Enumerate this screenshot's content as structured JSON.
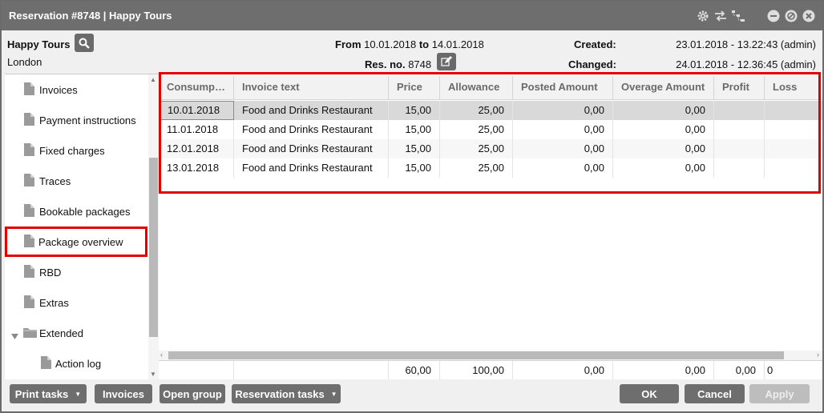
{
  "window": {
    "title": "Reservation #8748 | Happy Tours"
  },
  "header": {
    "name": "Happy Tours",
    "city": "London",
    "from_label": "From",
    "from_date": "10.01.2018",
    "to_label": "to",
    "to_date": "14.01.2018",
    "resno_label": "Res. no.",
    "resno": "8748",
    "created_label": "Created:",
    "created_value": "23.01.2018 - 13.22:43 (admin)",
    "changed_label": "Changed:",
    "changed_value": "24.01.2018 - 12.36:45 (admin)"
  },
  "sidebar": {
    "items": [
      {
        "label": "Invoices"
      },
      {
        "label": "Payment instructions"
      },
      {
        "label": "Fixed charges"
      },
      {
        "label": "Traces"
      },
      {
        "label": "Bookable packages"
      },
      {
        "label": "Package overview"
      },
      {
        "label": "RBD"
      },
      {
        "label": "Extras"
      },
      {
        "label": "Extended"
      },
      {
        "label": "Action log"
      }
    ]
  },
  "table": {
    "columns": [
      "Consump…",
      "Invoice text",
      "Price",
      "Allowance",
      "Posted Amount",
      "Overage Amount",
      "Profit",
      "Loss"
    ],
    "rows": [
      [
        "10.01.2018",
        "Food and Drinks Restaurant",
        "15,00",
        "25,00",
        "0,00",
        "0,00",
        "",
        ""
      ],
      [
        "11.01.2018",
        "Food and Drinks Restaurant",
        "15,00",
        "25,00",
        "0,00",
        "0,00",
        "",
        ""
      ],
      [
        "12.01.2018",
        "Food and Drinks Restaurant",
        "15,00",
        "25,00",
        "0,00",
        "0,00",
        "",
        ""
      ],
      [
        "13.01.2018",
        "Food and Drinks Restaurant",
        "15,00",
        "25,00",
        "0,00",
        "0,00",
        "",
        ""
      ]
    ],
    "totals": [
      "",
      "",
      "60,00",
      "100,00",
      "0,00",
      "0,00",
      "0,00",
      "0"
    ]
  },
  "footer": {
    "print_tasks": "Print tasks",
    "invoices": "Invoices",
    "open_group": "Open group",
    "reservation_tasks": "Reservation tasks",
    "ok": "OK",
    "cancel": "Cancel",
    "apply": "Apply"
  },
  "colors": {
    "titlebar": "#6e6e6e",
    "highlight": "#e00000",
    "button": "#6e6e6e"
  }
}
